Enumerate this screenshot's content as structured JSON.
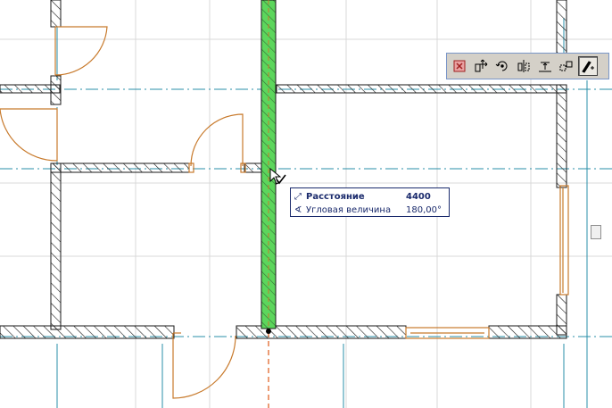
{
  "app": {
    "name": "floor-plan-editor"
  },
  "palette": {
    "buttons": [
      {
        "id": "close",
        "icon": "close-icon"
      },
      {
        "id": "drag",
        "icon": "move-arrows-icon"
      },
      {
        "id": "rotate",
        "icon": "rotate-icon"
      },
      {
        "id": "mirror",
        "icon": "mirror-icon"
      },
      {
        "id": "elevate",
        "icon": "elevate-icon"
      },
      {
        "id": "multiply",
        "icon": "multiply-copy-icon"
      },
      {
        "id": "stretch",
        "icon": "stretch-pencil-icon",
        "active": true
      }
    ]
  },
  "tracker": {
    "distance_label": "Расстояние",
    "distance_value": "4400",
    "angle_label": "Угловая величина",
    "angle_value": "180,00°"
  },
  "colors": {
    "wall_hatch": "#1a1a1a",
    "door_swing": "#c87a2c",
    "grid_axis": "#2a8fa8",
    "selection_fill": "#5cd65c",
    "tracker_border": "#1a2a6c"
  }
}
